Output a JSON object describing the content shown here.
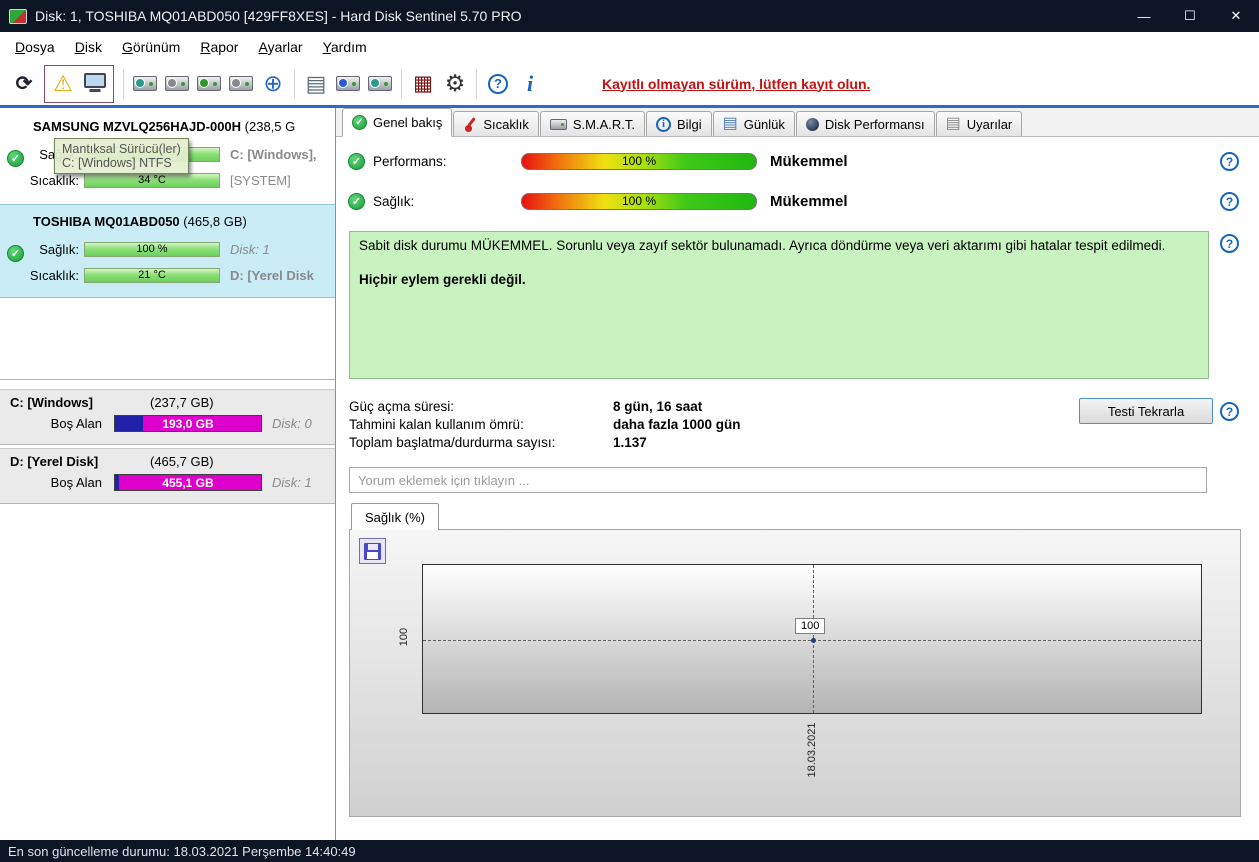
{
  "window": {
    "title": "Disk: 1, TOSHIBA MQ01ABD050 [429FF8XES]  -  Hard Disk Sentinel 5.70 PRO"
  },
  "icons": {
    "minimize": "—",
    "maximize": "☐",
    "close": "✕",
    "refresh": "⟳",
    "warning": "⚠",
    "globe": "⊕",
    "report": "▤",
    "surface_test": "▦",
    "settings": "⚙",
    "help": "?",
    "info": "i",
    "question": "?",
    "check": "✓",
    "doc": "▤"
  },
  "menu": {
    "items": [
      "Dosya",
      "Disk",
      "Görünüm",
      "Rapor",
      "Ayarlar",
      "Yardım"
    ]
  },
  "toolbar": {
    "register_notice": "Kayıtlı olmayan sürüm, lütfen kayıt olun."
  },
  "tabs": [
    "Genel bakış",
    "Sıcaklık",
    "S.M.A.R.T.",
    "Bilgi",
    "Günlük",
    "Disk Performansı",
    "Uyarılar"
  ],
  "sidebar": {
    "disk1": {
      "name": "SAMSUNG MZVLQ256HAJD-000H",
      "size": "(238,5 G",
      "health_label": "Sağlık:",
      "temp_label": "Sıcaklık:",
      "temp_value": "34 °C",
      "drive": "C: [Windows],",
      "system": "[SYSTEM]"
    },
    "tooltip": {
      "line1": "Mantıksal Sürücü(ler)",
      "line2": "C: [Windows] NTFS"
    },
    "disk2": {
      "name": "TOSHIBA MQ01ABD050",
      "size": "(465,8 GB)",
      "health_label": "Sağlık:",
      "health_value": "100 %",
      "disk_no": "Disk: 1",
      "temp_label": "Sıcaklık:",
      "temp_value": "21 °C",
      "drive": "D: [Yerel Disk"
    },
    "partitions": [
      {
        "name": "C: [Windows]",
        "size": "(237,7 GB)",
        "free_label": "Boş Alan",
        "free_value": "193,0 GB",
        "disk": "Disk: 0",
        "free_pct": 81
      },
      {
        "name": "D: [Yerel Disk]",
        "size": "(465,7 GB)",
        "free_label": "Boş Alan",
        "free_value": "455,1 GB",
        "disk": "Disk: 1",
        "free_pct": 97
      }
    ]
  },
  "overview": {
    "performance_label": "Performans:",
    "performance_value": "100 %",
    "performance_rating": "Mükemmel",
    "health_label": "Sağlık:",
    "health_value": "100 %",
    "health_rating": "Mükemmel",
    "status_text": "Sabit disk durumu MÜKEMMEL. Sorunlu veya zayıf sektör bulunamadı. Ayrıca döndürme veya veri aktarımı gibi hatalar tespit edilmedi.",
    "status_action": "Hiçbir eylem gerekli değil.",
    "info_rows": [
      {
        "label": "Güç açma süresi:",
        "value": "8 gün, 16 saat"
      },
      {
        "label": "Tahmini kalan kullanım ömrü:",
        "value": "daha fazla 1000 gün"
      },
      {
        "label": "Toplam başlatma/durdurma sayısı:",
        "value": "1.137"
      }
    ],
    "retest_button": "Testi Tekrarla",
    "comment_placeholder": "Yorum eklemek için tıklayın ..."
  },
  "chart": {
    "tab_label": "Sağlık (%)",
    "y_axis_label": "100",
    "point_label": "100",
    "x_axis_label": "18.03.2021"
  },
  "chart_data": {
    "type": "line",
    "title": "Sağlık (%)",
    "x": [
      "18.03.2021"
    ],
    "values": [
      100
    ],
    "x_ticks": [
      "18.03.2021"
    ],
    "y_ticks": [
      100
    ],
    "grid": "dashed-crosshair"
  },
  "statusbar": {
    "text": "En son güncelleme durumu: 18.03.2021 Perşembe 14:40:49"
  },
  "colors": {
    "titlebar": "#0b1524",
    "toolbar_accent": "#2f6bc4",
    "selected_disk_bg": "#c9ecf7",
    "free_space_magenta": "#dd00cc",
    "used_space_blue": "#2020a8",
    "health_green": "#7ddc6a",
    "status_box_green": "#c8f2c0",
    "notice_red": "#c41010"
  }
}
